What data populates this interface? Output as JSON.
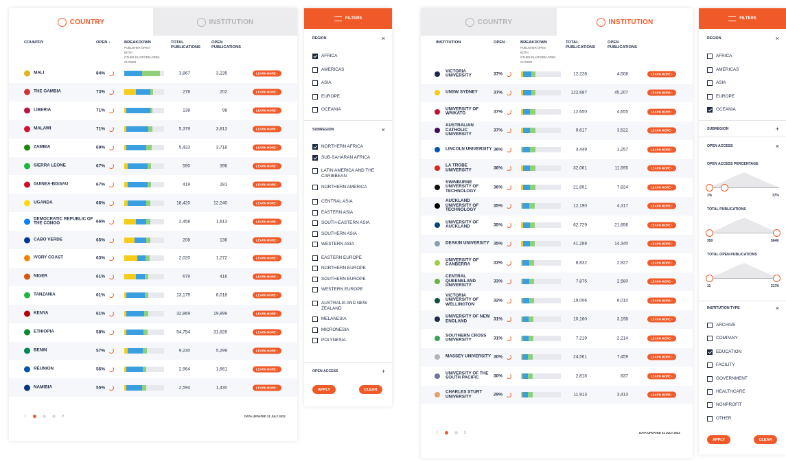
{
  "colors": {
    "accent": "#f05a28",
    "publisher": "#f5cc1a",
    "both": "#3a9fe0",
    "other": "#8fd17b",
    "closed": "#e7e9ee"
  },
  "left": {
    "tabs": {
      "country": "COUNTRY",
      "institution": "INSTITUTION"
    },
    "headers": {
      "name": "COUNTRY",
      "open": "OPEN ↓",
      "breakdown": "BREAKDOWN",
      "breakdown_sub": [
        "PUBLISHER OPEN",
        "BOTH",
        "OTHER PLATFORM OPEN",
        "CLOSED"
      ],
      "total": "TOTAL PUBLICATIONS",
      "open_pubs": "OPEN PUBLICATIONS"
    },
    "learn_more": "LEARN MORE ›",
    "rows": [
      {
        "name": "MALI",
        "open": "84%",
        "total": "3,867",
        "open_pubs": "3,235",
        "flag": "#e0b21c",
        "bd": [
          0.0,
          0.45,
          0.45
        ]
      },
      {
        "name": "THE GAMBIA",
        "open": "73%",
        "total": "278",
        "open_pubs": "202",
        "flag": "#d2343c",
        "bd": [
          0.3,
          0.35,
          0.08
        ]
      },
      {
        "name": "LIBERIA",
        "open": "71%",
        "total": "138",
        "open_pubs": "98",
        "flag": "#b31942",
        "bd": [
          0.05,
          0.6,
          0.06
        ]
      },
      {
        "name": "MALAWI",
        "open": "71%",
        "total": "5,379",
        "open_pubs": "3,813",
        "flag": "#d21034",
        "bd": [
          0.06,
          0.55,
          0.1
        ]
      },
      {
        "name": "ZAMBIA",
        "open": "69%",
        "total": "5,423",
        "open_pubs": "3,718",
        "flag": "#198a00",
        "bd": [
          0.06,
          0.5,
          0.13
        ]
      },
      {
        "name": "SIERRA LEONE",
        "open": "67%",
        "total": "590",
        "open_pubs": "396",
        "flag": "#1eb53a",
        "bd": [
          0.08,
          0.5,
          0.09
        ]
      },
      {
        "name": "GUINEA-BISSAU",
        "open": "67%",
        "total": "419",
        "open_pubs": "281",
        "flag": "#ce1126",
        "bd": [
          0.08,
          0.5,
          0.09
        ]
      },
      {
        "name": "UGANDA",
        "open": "66%",
        "total": "18,420",
        "open_pubs": "12,240",
        "flag": "#fcdc04",
        "bd": [
          0.08,
          0.48,
          0.1
        ]
      },
      {
        "name": "DEMOCRATIC REPUBLIC OF THE CONGO",
        "open": "66%",
        "total": "2,458",
        "open_pubs": "1,613",
        "flag": "#007fff",
        "bd": [
          0.3,
          0.25,
          0.11
        ]
      },
      {
        "name": "CABO VERDE",
        "open": "65%",
        "total": "208",
        "open_pubs": "136",
        "flag": "#003893",
        "bd": [
          0.25,
          0.3,
          0.1
        ]
      },
      {
        "name": "IVORY COAST",
        "open": "63%",
        "total": "2,020",
        "open_pubs": "1,272",
        "flag": "#f77f00",
        "bd": [
          0.33,
          0.2,
          0.1
        ]
      },
      {
        "name": "NIGER",
        "open": "61%",
        "total": "679",
        "open_pubs": "416",
        "flag": "#e05206",
        "bd": [
          0.3,
          0.22,
          0.09
        ]
      },
      {
        "name": "TANZANIA",
        "open": "61%",
        "total": "13,179",
        "open_pubs": "8,018",
        "flag": "#1eb53a",
        "bd": [
          0.05,
          0.46,
          0.1
        ]
      },
      {
        "name": "KENYA",
        "open": "61%",
        "total": "32,869",
        "open_pubs": "19,899",
        "flag": "#bb0000",
        "bd": [
          0.05,
          0.45,
          0.11
        ]
      },
      {
        "name": "ETHIOPIA",
        "open": "58%",
        "total": "54,754",
        "open_pubs": "31,826",
        "flag": "#078930",
        "bd": [
          0.06,
          0.42,
          0.1
        ]
      },
      {
        "name": "BENIN",
        "open": "57%",
        "total": "9,230",
        "open_pubs": "5,299",
        "flag": "#008751",
        "bd": [
          0.08,
          0.38,
          0.11
        ]
      },
      {
        "name": "RÉUNION",
        "open": "56%",
        "total": "2,964",
        "open_pubs": "1,661",
        "flag": "#0055a4",
        "bd": [
          0.06,
          0.4,
          0.1
        ]
      },
      {
        "name": "NAMIBIA",
        "open": "55%",
        "total": "2,594",
        "open_pubs": "1,430",
        "flag": "#003580",
        "bd": [
          0.06,
          0.38,
          0.11
        ]
      }
    ],
    "updated": "DATA UPDATED 31 JULY 2022"
  },
  "filters_left": {
    "header": "FILTERS",
    "region_title": "REGION",
    "regions": [
      {
        "label": "AFRICA",
        "checked": true
      },
      {
        "label": "AMERICAS",
        "checked": false
      },
      {
        "label": "ASIA",
        "checked": false
      },
      {
        "label": "EUROPE",
        "checked": false
      },
      {
        "label": "OCEANIA",
        "checked": false
      }
    ],
    "subregion_title": "SUBREGION",
    "subregions": [
      {
        "label": "NORTHERN AFRICA",
        "checked": true
      },
      {
        "label": "SUB-SAHARAN AFRICA",
        "checked": true
      },
      {
        "label": "LATIN AMERICA AND THE CARIBBEAN",
        "checked": false
      },
      {
        "label": "NORTHERN AMERICA",
        "checked": false
      },
      {
        "label": "CENTRAL ASIA",
        "checked": false
      },
      {
        "label": "EASTERN ASIA",
        "checked": false
      },
      {
        "label": "SOUTH-EASTERN ASIA",
        "checked": false
      },
      {
        "label": "SOUTHERN ASIA",
        "checked": false
      },
      {
        "label": "WESTERN ASIA",
        "checked": false
      },
      {
        "label": "EASTERN EUROPE",
        "checked": false
      },
      {
        "label": "NORTHERN EUROPE",
        "checked": false
      },
      {
        "label": "SOUTHERN EUROPE",
        "checked": false
      },
      {
        "label": "WESTERN EUROPE",
        "checked": false
      },
      {
        "label": "AUSTRALIA AND NEW ZEALAND",
        "checked": false
      },
      {
        "label": "MELANESIA",
        "checked": false
      },
      {
        "label": "MICRONESIA",
        "checked": false
      },
      {
        "label": "POLYNESIA",
        "checked": false
      }
    ],
    "open_access_title": "OPEN ACCESS",
    "apply": "APPLY",
    "clear": "CLEAR"
  },
  "right": {
    "tabs": {
      "country": "COUNTRY",
      "institution": "INSTITUTION"
    },
    "headers": {
      "name": "INSTITUTION",
      "open": "OPEN ↓",
      "breakdown": "BREAKDOWN",
      "breakdown_sub": [
        "PUBLISHER OPEN",
        "BOTH",
        "OTHER PLATFORM OPEN",
        "CLOSED"
      ],
      "total": "TOTAL PUBLICATIONS",
      "open_pubs": "OPEN PUBLICATIONS"
    },
    "learn_more": "LEARN MORE ›",
    "rows": [
      {
        "name": "VICTORIA UNIVERSITY",
        "open": "37%",
        "total": "12,228",
        "open_pubs": "4,508",
        "flag": "#1f2a44",
        "bd": [
          0.06,
          0.2,
          0.11
        ]
      },
      {
        "name": "UNSW SYDNEY",
        "open": "37%",
        "total": "122,687",
        "open_pubs": "45,207",
        "flag": "#f5cc1a",
        "bd": [
          0.06,
          0.2,
          0.11
        ]
      },
      {
        "name": "UNIVERSITY OF WAIKATO",
        "open": "37%",
        "total": "12,650",
        "open_pubs": "4,655",
        "flag": "#c8102e",
        "bd": [
          0.05,
          0.17,
          0.15
        ]
      },
      {
        "name": "AUSTRALIAN CATHOLIC UNIVERSITY",
        "open": "37%",
        "total": "9,617",
        "open_pubs": "3,522",
        "flag": "#3c1053",
        "bd": [
          0.05,
          0.18,
          0.14
        ]
      },
      {
        "name": "LINCOLN UNIVERSITY",
        "open": "36%",
        "total": "3,449",
        "open_pubs": "1,257",
        "flag": "#0057b8",
        "bd": [
          0.04,
          0.18,
          0.14
        ]
      },
      {
        "name": "LA TROBE UNIVERSITY",
        "open": "36%",
        "total": "32,061",
        "open_pubs": "11,595",
        "flag": "#e2231a",
        "bd": [
          0.05,
          0.17,
          0.14
        ]
      },
      {
        "name": "SWINBURNE UNIVERSITY OF TECHNOLOGY",
        "open": "36%",
        "total": "21,891",
        "open_pubs": "7,824",
        "flag": "#111111",
        "bd": [
          0.05,
          0.17,
          0.14
        ]
      },
      {
        "name": "AUCKLAND UNIVERSITY OF TECHNOLOGY",
        "open": "35%",
        "total": "12,190",
        "open_pubs": "4,317",
        "flag": "#000000",
        "bd": [
          0.04,
          0.16,
          0.15
        ]
      },
      {
        "name": "UNIVERSITY OF AUCKLAND",
        "open": "35%",
        "total": "62,729",
        "open_pubs": "21,856",
        "flag": "#00467f",
        "bd": [
          0.05,
          0.18,
          0.12
        ]
      },
      {
        "name": "DEAKIN UNIVERSITY",
        "open": "35%",
        "total": "41,288",
        "open_pubs": "14,340",
        "flag": "#8c9bb0",
        "bd": [
          0.05,
          0.17,
          0.13
        ]
      },
      {
        "name": "UNIVERSITY OF CANBERRA",
        "open": "33%",
        "total": "8,832",
        "open_pubs": "2,927",
        "flag": "#9ecf40",
        "bd": [
          0.04,
          0.16,
          0.13
        ]
      },
      {
        "name": "CENTRAL QUEENSLAND UNIVERSITY",
        "open": "33%",
        "total": "7,875",
        "open_pubs": "2,580",
        "flag": "#6cb33f",
        "bd": [
          0.04,
          0.16,
          0.13
        ]
      },
      {
        "name": "VICTORIA UNIVERSITY OF WELLINGTON",
        "open": "32%",
        "total": "19,006",
        "open_pubs": "6,010",
        "flag": "#0f4f3c",
        "bd": [
          0.04,
          0.16,
          0.12
        ]
      },
      {
        "name": "UNIVERSITY OF NEW ENGLAND",
        "open": "31%",
        "total": "10,160",
        "open_pubs": "3,198",
        "flag": "#1f2a44",
        "bd": [
          0.04,
          0.15,
          0.12
        ]
      },
      {
        "name": "SOUTHERN CROSS UNIVERSITY",
        "open": "31%",
        "total": "7,219",
        "open_pubs": "2,214",
        "flag": "#3aa655",
        "bd": [
          0.04,
          0.15,
          0.12
        ]
      },
      {
        "name": "MASSEY UNIVERSITY",
        "open": "30%",
        "total": "24,561",
        "open_pubs": "7,459",
        "flag": "#b0b3bb",
        "bd": [
          0.04,
          0.14,
          0.12
        ]
      },
      {
        "name": "UNIVERSITY OF THE SOUTH PACIFIC",
        "open": "30%",
        "total": "2,818",
        "open_pubs": "837",
        "flag": "#6b7a99",
        "bd": [
          0.04,
          0.14,
          0.12
        ]
      },
      {
        "name": "CHARLES STURT UNIVERSITY",
        "open": "29%",
        "total": "11,913",
        "open_pubs": "3,413",
        "flag": "#e8a06b",
        "bd": [
          0.04,
          0.14,
          0.11
        ]
      }
    ],
    "updated": "DATA UPDATED 31 JULY 2022"
  },
  "filters_right": {
    "header": "FILTERS",
    "region_title": "REGION",
    "regions": [
      {
        "label": "AFRICA",
        "checked": false
      },
      {
        "label": "AMERICAS",
        "checked": false
      },
      {
        "label": "ASIA",
        "checked": false
      },
      {
        "label": "EUROPE",
        "checked": false
      },
      {
        "label": "OCEANIA",
        "checked": true
      }
    ],
    "subregion_title": "SUBREGION",
    "open_access_title": "OPEN ACCESS",
    "sliders": [
      {
        "title": "OPEN ACCESS PERCENTAGE",
        "min": "1%",
        "max": "37%",
        "lo": 0.0,
        "hi": 0.28
      },
      {
        "title": "TOTAL PUBLICATIONS",
        "min": "350",
        "max": "564K",
        "lo": 0.0,
        "hi": 1.0
      },
      {
        "title": "TOTAL OPEN PUBLICATIONS",
        "min": "11",
        "max": "217K",
        "lo": 0.0,
        "hi": 1.0
      }
    ],
    "type_title": "INSTITUTION TYPE",
    "types": [
      {
        "label": "ARCHIVE",
        "checked": false
      },
      {
        "label": "COMPANY",
        "checked": false
      },
      {
        "label": "EDUCATION",
        "checked": true
      },
      {
        "label": "FACILITY",
        "checked": false
      },
      {
        "label": "GOVERNMENT",
        "checked": false
      },
      {
        "label": "HEALTHCARE",
        "checked": false
      },
      {
        "label": "NONPROFIT",
        "checked": false
      },
      {
        "label": "OTHER",
        "checked": false
      }
    ],
    "apply": "APPLY",
    "clear": "CLEAR"
  }
}
